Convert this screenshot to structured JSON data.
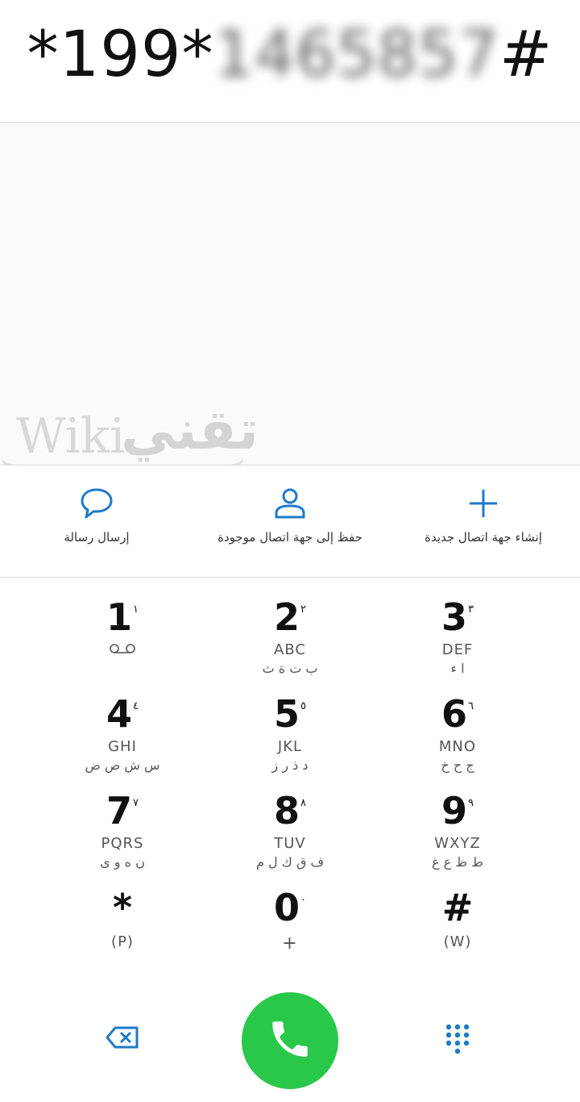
{
  "dialer": {
    "number_prefix": "*199*",
    "number_masked": "1465857",
    "number_suffix": "#"
  },
  "watermark": {
    "latin": "Wiki",
    "arabic": "تقني"
  },
  "actions": [
    {
      "label": "إرسال رسالة",
      "icon": "message-bubble-icon"
    },
    {
      "label": "حفظ إلى جهة اتصال موجودة",
      "icon": "person-icon"
    },
    {
      "label": "إنشاء جهة اتصال جديدة",
      "icon": "plus-icon"
    }
  ],
  "keys": [
    {
      "digit": "1",
      "ar": "١",
      "letters": "",
      "ar_letters": "",
      "voicemail": true
    },
    {
      "digit": "2",
      "ar": "٢",
      "letters": "ABC",
      "ar_letters": "ب ت ة ث"
    },
    {
      "digit": "3",
      "ar": "٣",
      "letters": "DEF",
      "ar_letters": "ا ء"
    },
    {
      "digit": "4",
      "ar": "٤",
      "letters": "GHI",
      "ar_letters": "س ش ص ض"
    },
    {
      "digit": "5",
      "ar": "٥",
      "letters": "JKL",
      "ar_letters": "د ذ ر ز"
    },
    {
      "digit": "6",
      "ar": "٦",
      "letters": "MNO",
      "ar_letters": "ج ح خ"
    },
    {
      "digit": "7",
      "ar": "٧",
      "letters": "PQRS",
      "ar_letters": "ن ه و ى"
    },
    {
      "digit": "8",
      "ar": "٨",
      "letters": "TUV",
      "ar_letters": "ف ق ك ل م"
    },
    {
      "digit": "9",
      "ar": "٩",
      "letters": "WXYZ",
      "ar_letters": "ط ظ ع غ"
    },
    {
      "digit": "*",
      "ar": "",
      "letters": "(P)",
      "ar_letters": ""
    },
    {
      "digit": "0",
      "ar": "٠",
      "letters": "+",
      "ar_letters": ""
    },
    {
      "digit": "#",
      "ar": "",
      "letters": "(W)",
      "ar_letters": ""
    }
  ],
  "colors": {
    "accent": "#1f7ac9",
    "call_green": "#2ac84a"
  },
  "bottom": {
    "delete_icon": "backspace-icon",
    "call_icon": "phone-icon",
    "dialpad_icon": "dialpad-icon"
  }
}
